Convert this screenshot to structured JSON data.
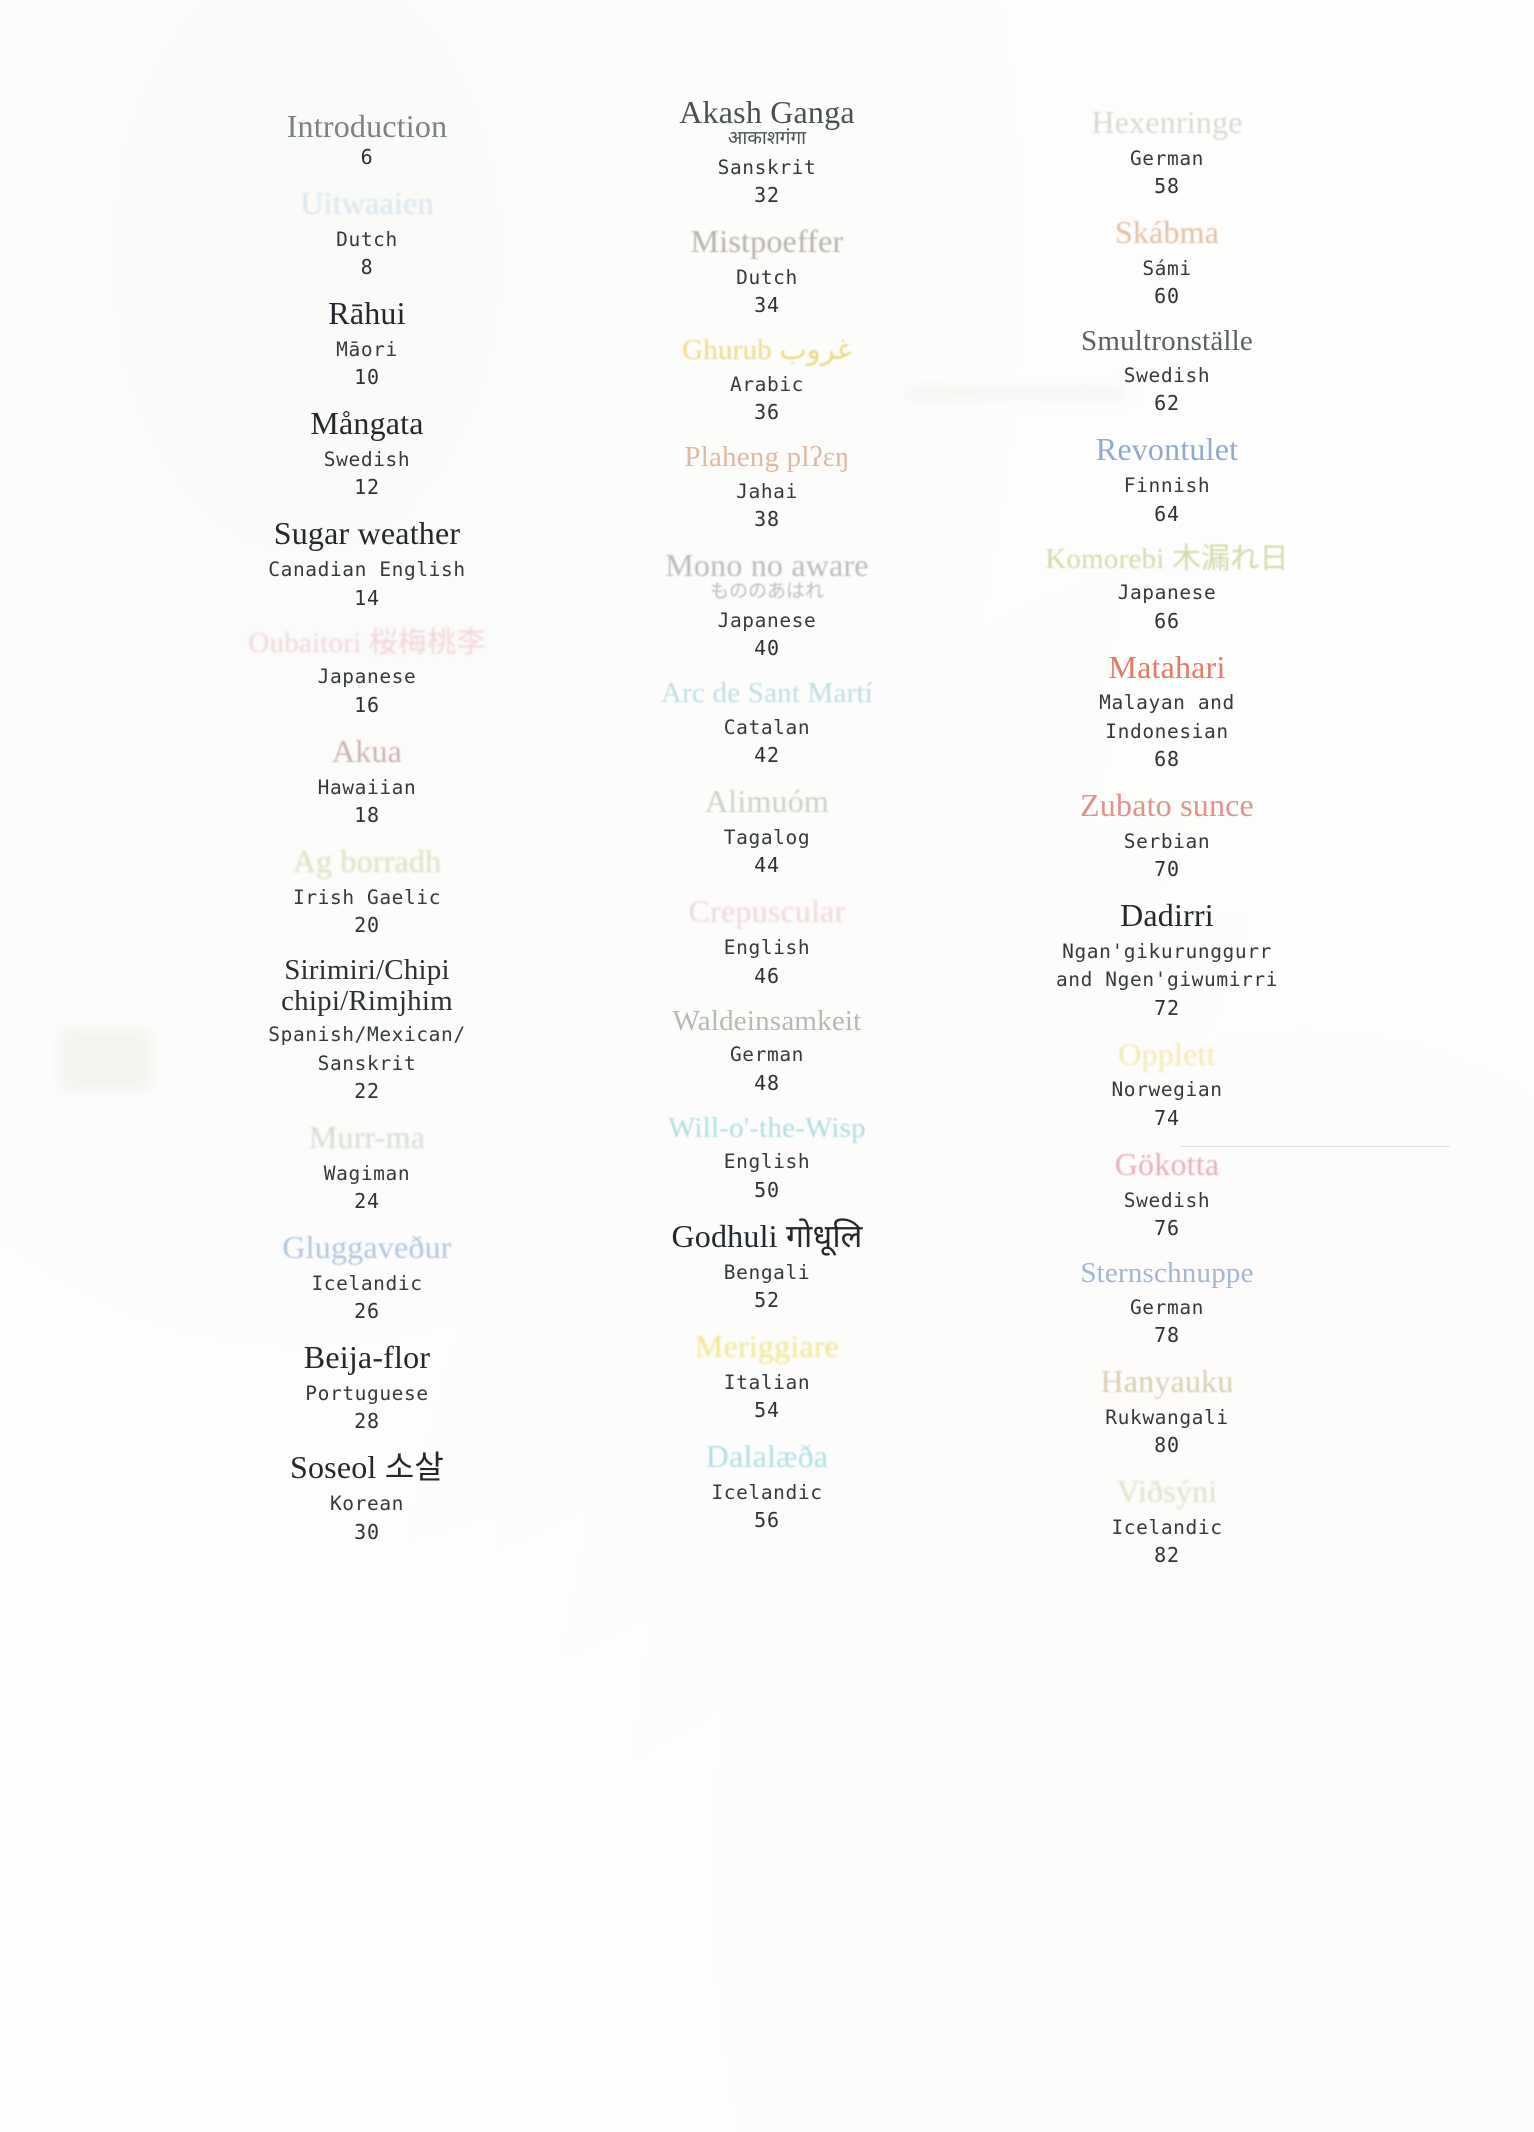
{
  "page": {
    "kind": "table-of-contents",
    "columns": 3
  },
  "colors": {
    "ink": "#2b3134",
    "mono_ink": "#333a3d",
    "pink": "#e9b9c4",
    "rose": "#d08f9a",
    "salmon": "#c88a6a",
    "tan": "#c79a6e",
    "gold": "#e8d26a",
    "yellow": "#efe07a",
    "sage": "#b9c4a4",
    "green_pale": "#cdd9b4",
    "grey_green": "#8e9c92",
    "cyan": "#b7dfe2",
    "sky": "#9fb8d6",
    "blue": "#7e9ec4",
    "lilac": "#b9a8c4",
    "red": "#d4625a",
    "orange_red": "#d96a4a"
  },
  "columns": [
    {
      "name": "column-1",
      "entries": [
        {
          "title": "Introduction",
          "native": "",
          "language": "",
          "page": "6",
          "color": "#4a5558",
          "fade": "faded-2",
          "blur": "",
          "size": ""
        },
        {
          "title": "Uitwaaien",
          "native": "",
          "language": "Dutch",
          "page": "8",
          "color": "#b7cfe0",
          "fade": "faded-3",
          "blur": "blur-3",
          "size": ""
        },
        {
          "title": "Rāhui",
          "native": "",
          "language": "Māori",
          "page": "10",
          "color": "#22282b",
          "fade": "",
          "blur": "",
          "size": ""
        },
        {
          "title": "Mångata",
          "native": "",
          "language": "Swedish",
          "page": "12",
          "color": "#22282b",
          "fade": "",
          "blur": "",
          "size": ""
        },
        {
          "title": "Sugar weather",
          "native": "",
          "language": "Canadian English",
          "page": "14",
          "color": "#22282b",
          "fade": "",
          "blur": "",
          "size": ""
        },
        {
          "title": "Oubaitori 桜梅桃李",
          "native": "",
          "language": "Japanese",
          "page": "16",
          "color": "#edc3cd",
          "fade": "faded-2",
          "blur": "blur-3",
          "size": "sm"
        },
        {
          "title": "Akua",
          "native": "",
          "language": "Hawaiian",
          "page": "18",
          "color": "#b9969b",
          "fade": "faded-2",
          "blur": "blur-2",
          "size": ""
        },
        {
          "title": "Ag borradh",
          "native": "",
          "language": "Irish Gaelic",
          "page": "20",
          "color": "#cdd4a2",
          "fade": "faded-2",
          "blur": "blur-3",
          "size": ""
        },
        {
          "title": "Sirimiri/Chipi\nchipi/Rimjhim",
          "native": "",
          "language": "Spanish/Mexican/\nSanskrit",
          "page": "22",
          "color": "#2a3033",
          "fade": "",
          "blur": "",
          "size": "sm"
        },
        {
          "title": "Murr-ma",
          "native": "",
          "language": "Wagiman",
          "page": "24",
          "color": "#bfcfc0",
          "fade": "faded-2",
          "blur": "blur-3",
          "size": ""
        },
        {
          "title": "Gluggaveður",
          "native": "",
          "language": "Icelandic",
          "page": "26",
          "color": "#94b1d2",
          "fade": "faded-2",
          "blur": "blur-2",
          "size": ""
        },
        {
          "title": "Beija-flor",
          "native": "",
          "language": "Portuguese",
          "page": "28",
          "color": "#22282b",
          "fade": "",
          "blur": "",
          "size": ""
        },
        {
          "title": "Soseol 소살",
          "native": "",
          "language": "Korean",
          "page": "30",
          "color": "#22282b",
          "fade": "",
          "blur": "",
          "size": ""
        }
      ]
    },
    {
      "name": "column-2",
      "entries": [
        {
          "title": "Akash Ganga",
          "native": "आकाशगंगा",
          "language": "Sanskrit",
          "page": "32",
          "color": "#3b4347",
          "fade": "faded-1",
          "blur": "blur-1",
          "size": ""
        },
        {
          "title": "Mistpoeffer",
          "native": "",
          "language": "Dutch",
          "page": "34",
          "color": "#9e958e",
          "fade": "faded-2",
          "blur": "blur-2",
          "size": ""
        },
        {
          "title": "Ghurub غروب",
          "native": "",
          "language": "Arabic",
          "page": "36",
          "color": "#ebd879",
          "fade": "faded-1",
          "blur": "blur-2",
          "size": "sm"
        },
        {
          "title": "Plaheng plʔɛŋ",
          "native": "",
          "language": "Jahai",
          "page": "38",
          "color": "#d3a183",
          "fade": "faded-2",
          "blur": "blur-1",
          "size": "sm"
        },
        {
          "title": "Mono no aware",
          "native": "もののあはれ",
          "language": "Japanese",
          "page": "40",
          "color": "#9fa6a8",
          "fade": "faded-2",
          "blur": "blur-2",
          "size": ""
        },
        {
          "title": "Arc de Sant Martí",
          "native": "",
          "language": "Catalan",
          "page": "42",
          "color": "#b6dbe0",
          "fade": "faded-1",
          "blur": "blur-2",
          "size": "sm"
        },
        {
          "title": "Alimuóm",
          "native": "",
          "language": "Tagalog",
          "page": "44",
          "color": "#b4c4ae",
          "fade": "faded-2",
          "blur": "blur-2",
          "size": ""
        },
        {
          "title": "Crepuscular",
          "native": "",
          "language": "English",
          "page": "46",
          "color": "#e7c4cb",
          "fade": "faded-2",
          "blur": "blur-3",
          "size": ""
        },
        {
          "title": "Waldeinsamkeit",
          "native": "",
          "language": "German",
          "page": "48",
          "color": "#94a39a",
          "fade": "faded-2",
          "blur": "blur-1",
          "size": "sm"
        },
        {
          "title": "Will-o'-the-Wisp",
          "native": "",
          "language": "English",
          "page": "50",
          "color": "#a8dbdd",
          "fade": "faded-1",
          "blur": "blur-2",
          "size": "sm"
        },
        {
          "title": "Godhuli गोधूलि",
          "native": "",
          "language": "Bengali",
          "page": "52",
          "color": "#22282b",
          "fade": "",
          "blur": "",
          "size": ""
        },
        {
          "title": "Meriggiare",
          "native": "",
          "language": "Italian",
          "page": "54",
          "color": "#efe27c",
          "fade": "faded-1",
          "blur": "blur-3",
          "size": ""
        },
        {
          "title": "Dalalæða",
          "native": "",
          "language": "Icelandic",
          "page": "56",
          "color": "#a9dee4",
          "fade": "faded-1",
          "blur": "blur-2",
          "size": ""
        }
      ]
    },
    {
      "name": "column-3",
      "entries": [
        {
          "title": "Hexenringe",
          "native": "",
          "language": "German",
          "page": "58",
          "color": "#c3cfbc",
          "fade": "faded-2",
          "blur": "blur-2",
          "size": ""
        },
        {
          "title": "Skábma",
          "native": "",
          "language": "Sámi",
          "page": "60",
          "color": "#d9a87e",
          "fade": "faded-2",
          "blur": "blur-2",
          "size": ""
        },
        {
          "title": "Smultronställe",
          "native": "",
          "language": "Swedish",
          "page": "62",
          "color": "#4d5457",
          "fade": "faded-1",
          "blur": "blur-1",
          "size": "sm"
        },
        {
          "title": "Revontulet",
          "native": "",
          "language": "Finnish",
          "page": "64",
          "color": "#8aa4c6",
          "fade": "faded-1",
          "blur": "blur-1",
          "size": ""
        },
        {
          "title": "Komorebi 木漏れ日",
          "native": "",
          "language": "Japanese",
          "page": "66",
          "color": "#ccd99e",
          "fade": "faded-1",
          "blur": "blur-2",
          "size": "sm"
        },
        {
          "title": "Matahari",
          "native": "",
          "language": "Malayan and\nIndonesian",
          "page": "68",
          "color": "#e0705c",
          "fade": "faded-1",
          "blur": "blur-1",
          "size": ""
        },
        {
          "title": "Zubato sunce",
          "native": "",
          "language": "Serbian",
          "page": "70",
          "color": "#e08a7e",
          "fade": "faded-1",
          "blur": "blur-1",
          "size": ""
        },
        {
          "title": "Dadirri",
          "native": "",
          "language": "Ngan'gikurunggurr\nand Ngen'giwumirri",
          "page": "72",
          "color": "#22282b",
          "fade": "",
          "blur": "",
          "size": ""
        },
        {
          "title": "Opplett",
          "native": "",
          "language": "Norwegian",
          "page": "74",
          "color": "#ecdf8a",
          "fade": "faded-2",
          "blur": "blur-3",
          "size": ""
        },
        {
          "title": "Gökotta",
          "native": "",
          "language": "Swedish",
          "page": "76",
          "color": "#dd8f9c",
          "fade": "faded-2",
          "blur": "blur-2",
          "size": ""
        },
        {
          "title": "Sternschnuppe",
          "native": "",
          "language": "German",
          "page": "78",
          "color": "#9ab2cf",
          "fade": "faded-1",
          "blur": "blur-1",
          "size": "sm"
        },
        {
          "title": "Hanyauku",
          "native": "",
          "language": "Rukwangali",
          "page": "80",
          "color": "#cbbd96",
          "fade": "faded-2",
          "blur": "blur-2",
          "size": ""
        },
        {
          "title": "Viðsýni",
          "native": "",
          "language": "Icelandic",
          "page": "82",
          "color": "#cdd6ae",
          "fade": "faded-2",
          "blur": "blur-3",
          "size": ""
        }
      ]
    }
  ]
}
